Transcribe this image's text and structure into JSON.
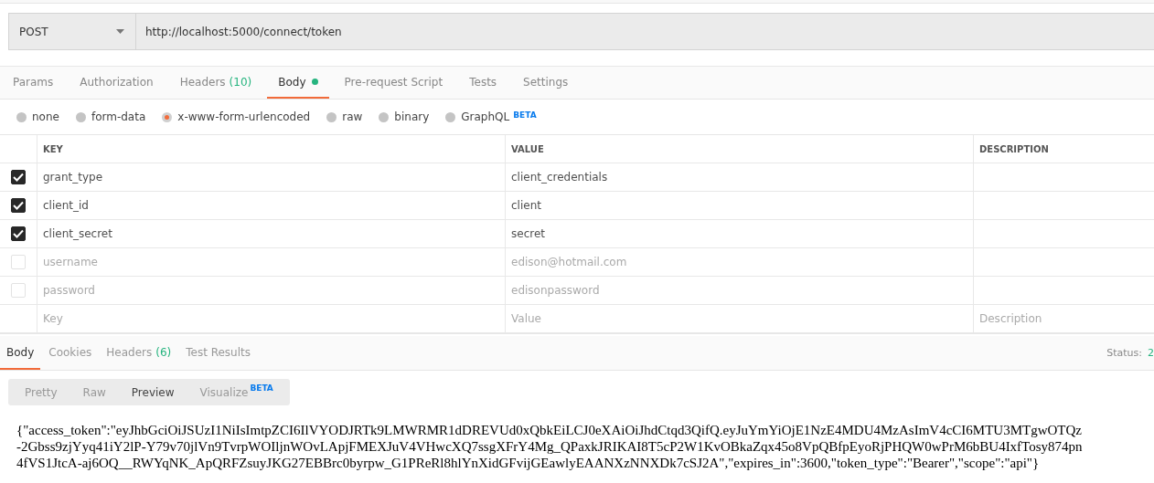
{
  "request": {
    "method": "POST",
    "url": "http://localhost:5000/connect/token"
  },
  "tabs": [
    {
      "label": "Params",
      "selected": false
    },
    {
      "label": "Authorization",
      "selected": false
    },
    {
      "label": "Headers",
      "count": "(10)",
      "selected": false
    },
    {
      "label": "Body",
      "dot": true,
      "selected": true
    },
    {
      "label": "Pre-request Script",
      "selected": false
    },
    {
      "label": "Tests",
      "selected": false
    },
    {
      "label": "Settings",
      "selected": false
    }
  ],
  "body_types": [
    {
      "label": "none",
      "selected": false
    },
    {
      "label": "form-data",
      "selected": false
    },
    {
      "label": "x-www-form-urlencoded",
      "selected": true
    },
    {
      "label": "raw",
      "selected": false
    },
    {
      "label": "binary",
      "selected": false
    },
    {
      "label": "GraphQL",
      "badge": "BETA",
      "selected": false
    }
  ],
  "table": {
    "columns": [
      "KEY",
      "VALUE",
      "DESCRIPTION"
    ],
    "rows": [
      {
        "key": "grant_type",
        "value": "client_credentials",
        "checked": true
      },
      {
        "key": "client_id",
        "value": "client",
        "checked": true
      },
      {
        "key": "client_secret",
        "value": "secret",
        "checked": true
      },
      {
        "key": "username",
        "value": "edison@hotmail.com",
        "checked": false
      },
      {
        "key": "password",
        "value": "edisonpassword",
        "checked": false
      }
    ],
    "new_row": {
      "key_placeholder": "Key",
      "value_placeholder": "Value",
      "description_placeholder": "Description"
    }
  },
  "response": {
    "tabs": [
      {
        "label": "Body",
        "selected": true
      },
      {
        "label": "Cookies",
        "selected": false
      },
      {
        "label": "Headers",
        "count": "(6)",
        "selected": false
      },
      {
        "label": "Test Results",
        "selected": false
      }
    ],
    "status_label": "Status:",
    "status_value": "2",
    "formats": [
      {
        "label": "Pretty",
        "selected": false
      },
      {
        "label": "Raw",
        "selected": false
      },
      {
        "label": "Preview",
        "selected": true
      },
      {
        "label": "Visualize",
        "badge": "BETA",
        "selected": false
      }
    ],
    "lines": [
      "{\"access_token\":\"eyJhbGciOiJSUzI1NiIsImtpZCI6IlVYODJRTk9LMWRMR1dDREVUd0xQbkEiLCJ0eXAiOiJhdCtqd3QifQ.eyJuYmYiOjE1NzE4MDU4MzAsImV4cCI6MTU3MTgwOTQz",
      "-2Gbss9zjYyq41iY2lP-Y79v70jlVn9TvrpWOIljnWOvLApjFMEXJuV4VHwcXQ7ssgXFrY4Mg_QPaxkJRIKAI8T5cP2W1KvOBkaZqx45o8VpQBfpEyoRjPHQW0wPrM6bBU4IxfTosy874pn",
      "4fVS1JtcA-aj6OQ__RWYqNK_ApQRFZsuyJKG27EBBrc0byrpw_G1PReRl8hlYnXidGFvijGEawlyEAANXzNNXDk7cSJ2A\",\"expires_in\":3600,\"token_type\":\"Bearer\",\"scope\":\"api\"}"
    ]
  }
}
